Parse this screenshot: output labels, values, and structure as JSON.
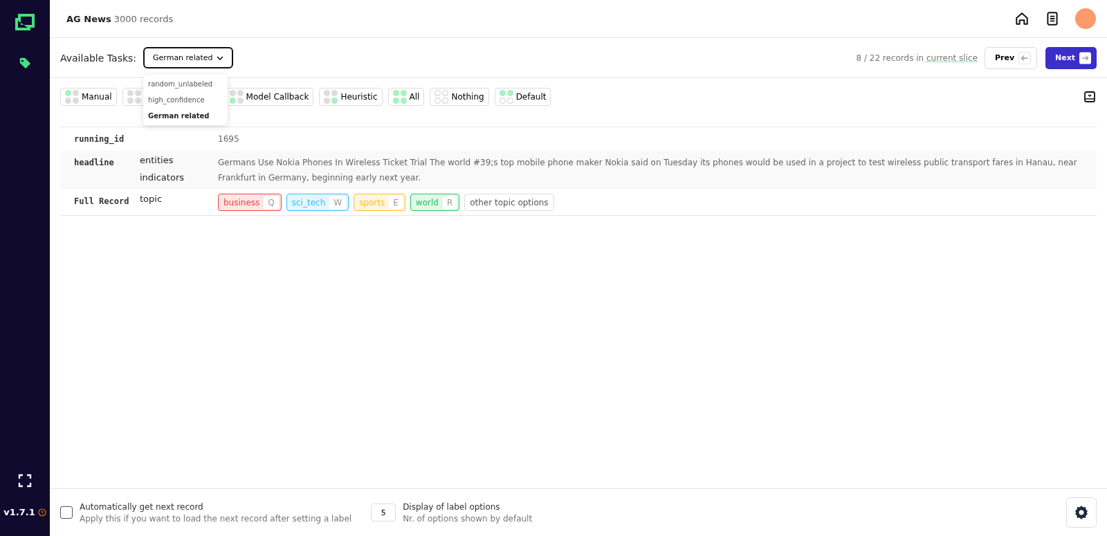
{
  "sidebar": {
    "version": "v1.7.1"
  },
  "header": {
    "project": "AG News",
    "records": "3000 records"
  },
  "toolbar": {
    "label": "Available Tasks:",
    "task": "German related",
    "progress": "8 / 22 records in ",
    "slice_link": "current slice",
    "prev": "Prev",
    "next": "Next"
  },
  "task_menu": {
    "items": [
      {
        "label": "random_unlabeled",
        "selected": false
      },
      {
        "label": "high_confidence",
        "selected": false
      },
      {
        "label": "German related",
        "selected": true
      }
    ]
  },
  "filters": [
    {
      "label": "Manual",
      "dots": [
        {
          "on": true,
          "hollow": false
        },
        {
          "on": false,
          "hollow": false
        },
        {
          "on": false,
          "hollow": false
        },
        {
          "on": false,
          "hollow": false
        }
      ]
    },
    {
      "dots": [
        {
          "on": false,
          "hollow": false
        },
        {
          "on": false,
          "hollow": false
        },
        {
          "on": false,
          "hollow": false
        },
        {
          "on": false,
          "hollow": false
        }
      ]
    },
    {
      "label": "Model Callback",
      "dots": [
        {
          "on": false,
          "hollow": false
        },
        {
          "on": false,
          "hollow": false
        },
        {
          "on": true,
          "hollow": false
        },
        {
          "on": false,
          "hollow": false
        }
      ]
    },
    {
      "label": "Heuristic",
      "dots": [
        {
          "on": false,
          "hollow": false
        },
        {
          "on": false,
          "hollow": false
        },
        {
          "on": false,
          "hollow": false
        },
        {
          "on": true,
          "hollow": false
        }
      ]
    },
    {
      "label": "All",
      "dots": [
        {
          "on": true,
          "hollow": false
        },
        {
          "on": true,
          "hollow": false
        },
        {
          "on": true,
          "hollow": false
        },
        {
          "on": true,
          "hollow": false
        }
      ]
    },
    {
      "label": "Nothing",
      "dots": [
        {
          "on": false,
          "hollow": true
        },
        {
          "on": false,
          "hollow": true
        },
        {
          "on": false,
          "hollow": true
        },
        {
          "on": false,
          "hollow": true
        }
      ]
    },
    {
      "label": "Default",
      "dots": [
        {
          "on": true,
          "hollow": false
        },
        {
          "on": true,
          "hollow": false
        },
        {
          "on": false,
          "hollow": true
        },
        {
          "on": false,
          "hollow": true
        }
      ]
    }
  ],
  "record": {
    "rows": [
      {
        "field": "running_id",
        "tasks": [],
        "value": "1695"
      },
      {
        "field": "headline",
        "tasks": [
          "entities",
          "indicators"
        ],
        "value": "Germans Use Nokia Phones In Wireless Ticket Trial The world #39;s top mobile phone maker Nokia said on Tuesday its phones would be used in a project to test wireless public transport fares in Hanau, near Frankfurt in Germany, beginning early next year."
      },
      {
        "field": "Full Record",
        "tasks": [
          "topic"
        ],
        "labels": [
          {
            "label": "business",
            "key": "Q",
            "color": "#ef4444"
          },
          {
            "label": "sci_tech",
            "key": "W",
            "color": "#38bdf8"
          },
          {
            "label": "sports",
            "key": "E",
            "color": "#fbbf24"
          },
          {
            "label": "world",
            "key": "R",
            "color": "#22c55e"
          }
        ],
        "more": "other topic options"
      }
    ]
  },
  "footer": {
    "auto_next": {
      "checked": false,
      "title": "Automatically get next record",
      "hint": "Apply this if you want to load the next record after setting a label"
    },
    "label_options": {
      "value": "5",
      "title": "Display of label options",
      "hint": "Nr. of options shown by default"
    }
  }
}
